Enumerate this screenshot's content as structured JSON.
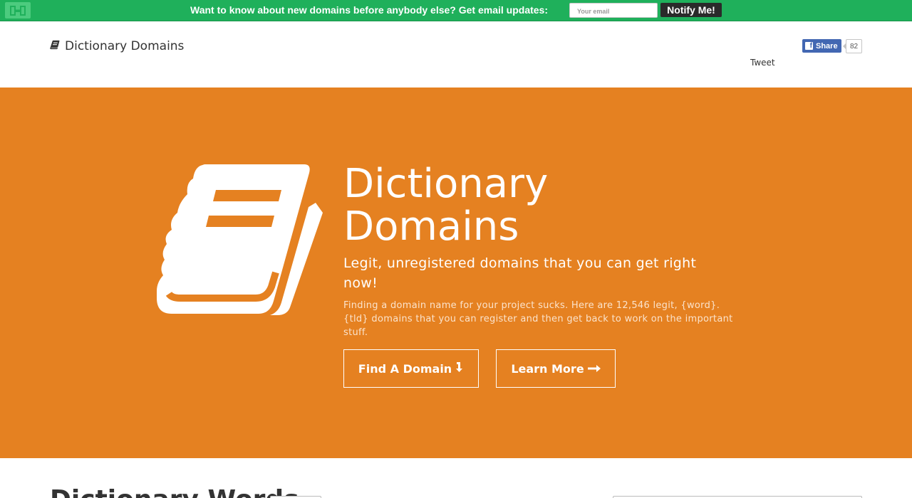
{
  "notify_bar": {
    "logo_icon": "hello-bar-h-icon",
    "message": "Want to know about new domains before anybody else? Get email updates:",
    "email_placeholder": "Your email",
    "button_label": "Notify Me!",
    "bg_color": "#1fb05b"
  },
  "header": {
    "brand_icon": "book-icon",
    "brand_label": "Dictionary Domains",
    "share_label": "Share",
    "share_count": "82",
    "tweet_label": "Tweet"
  },
  "hero": {
    "bg_color": "#e58121",
    "icon": "book-icon",
    "title_line1": "Dictionary",
    "title_line2": "Domains",
    "tagline": "Legit, unregistered domains that you can get right now!",
    "description": "Finding a domain name for your project sucks. Here are 12,546 legit, {word}.{tld} domains that you can register and then get back to work on the important stuff.",
    "find_button": "Find A Domain",
    "find_icon": "arrow-down-icon",
    "learn_button": "Learn More",
    "learn_icon": "arrow-right-icon"
  },
  "below": {
    "title": "Dictionary Words"
  }
}
